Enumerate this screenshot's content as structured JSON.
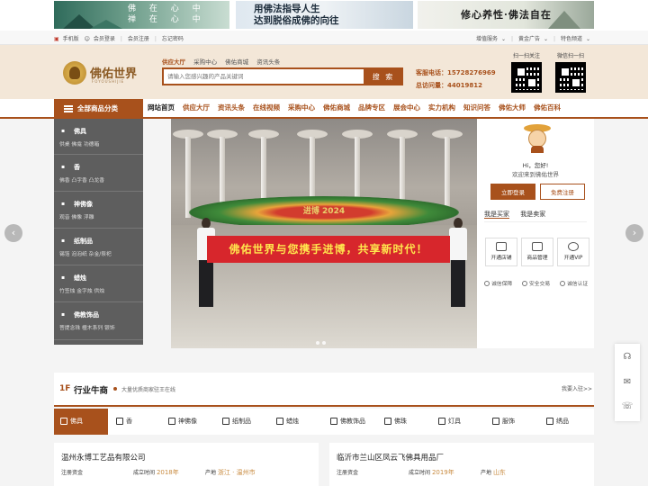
{
  "banners": [
    {
      "text": "佛 在 心 中\n禅 在 心 中"
    },
    {
      "text": "用佛法指导人生\n达到脱俗成佛的向往"
    },
    {
      "text": "修心养性·佛法自在"
    }
  ],
  "topbar": {
    "left": [
      "手机版",
      "会员登录",
      "会员注册",
      "忘记密码"
    ],
    "right": [
      "增值服务",
      "黄金广告",
      "特色频道"
    ]
  },
  "header": {
    "logo_text": "佛佑世界",
    "logo_sub": "FOYOUSHIJIE",
    "search_tabs": [
      "供应大厅",
      "采购中心",
      "佛佑商城",
      "资讯头条"
    ],
    "search_placeholder": "请输入您感兴趣的产品关键词",
    "search_button": "搜 索",
    "phone_label": "客服电话：15728276969",
    "visits_label": "总访问量：44019812",
    "qr_labels": [
      "扫一扫关注",
      "微信扫一扫"
    ]
  },
  "nav": {
    "all_categories": "全部商品分类",
    "items": [
      "网站首页",
      "供应大厅",
      "资讯头条",
      "在线视频",
      "采购中心",
      "佛佑商城",
      "品牌专区",
      "展会中心",
      "实力机构",
      "知识问答",
      "佛佑大师",
      "佛佑百科"
    ]
  },
  "categories": [
    {
      "title": "佛具",
      "sub": "供桌  佛龛  功德箱"
    },
    {
      "title": "香",
      "sub": "佛香  凸字香  凸龙香"
    },
    {
      "title": "神佛像",
      "sub": "观音  佛像  浮雕"
    },
    {
      "title": "纸制品",
      "sub": "锡箔  泡泡纸  杂金/祭祀"
    },
    {
      "title": "蜡烛",
      "sub": "竹签烛  金字烛  供烛"
    },
    {
      "title": "佛教饰品",
      "sub": "菩提念珠  檀木系列  银饰"
    }
  ],
  "hero": {
    "banner_text": "佛佑世界与您携手进博，共享新时代！",
    "sign_text": "进博 2024"
  },
  "user_panel": {
    "hi": "Hi，您好!",
    "welcome": "欢迎来到佛佑世界",
    "login": "立即登录",
    "register": "免费注册",
    "roles": [
      "我是买家",
      "我是卖家"
    ],
    "services": [
      "开通店铺",
      "商品管理",
      "开通VIP"
    ],
    "assurances": [
      "诚信保障",
      "安全交易",
      "诚信认证"
    ]
  },
  "section": {
    "floor": "1F",
    "title": "行业牛商",
    "subtitle": "大量优质商家驻王在线",
    "join": "我要入驻>>",
    "tabs": [
      "佛具",
      "香",
      "神佛像",
      "纸制品",
      "蜡烛",
      "佛教饰品",
      "佛珠",
      "灯具",
      "服饰",
      "绣品"
    ]
  },
  "companies": [
    {
      "name": "温州永博工艺品有限公司",
      "reg_label": "注册资金",
      "year_label": "成立时间",
      "year": "2018年",
      "area_label": "产地",
      "area": "浙江 · 温州市"
    },
    {
      "name": "临沂市兰山区凤云飞佛具用品厂",
      "reg_label": "注册资金",
      "year_label": "成立时间",
      "year": "2019年",
      "area_label": "产地",
      "area": "山东"
    }
  ],
  "colors": {
    "brand": "#a8511c",
    "sidebar": "#5e5e5e",
    "header_bg": "#f3e7d8"
  }
}
